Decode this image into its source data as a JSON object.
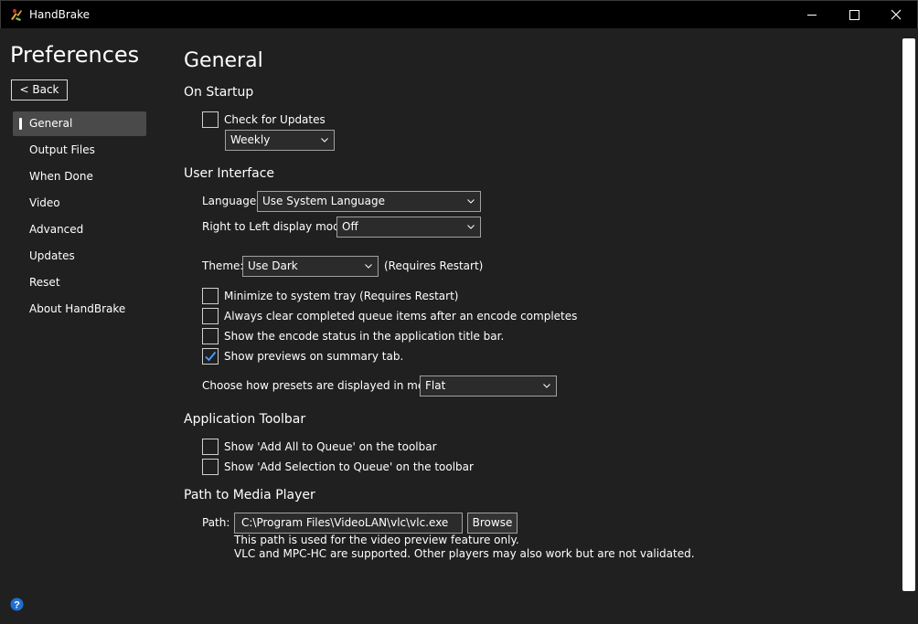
{
  "window": {
    "title": "HandBrake"
  },
  "sidebar": {
    "title": "Preferences",
    "back_label": "< Back",
    "items": [
      {
        "label": "General",
        "active": true
      },
      {
        "label": "Output Files"
      },
      {
        "label": "When Done"
      },
      {
        "label": "Video"
      },
      {
        "label": "Advanced"
      },
      {
        "label": "Updates"
      },
      {
        "label": "Reset"
      },
      {
        "label": "About HandBrake"
      }
    ]
  },
  "main": {
    "page_title": "General",
    "startup": {
      "heading": "On Startup",
      "check_updates": {
        "label": "Check for Updates",
        "checked": false
      },
      "frequency": {
        "value": "Weekly"
      }
    },
    "ui": {
      "heading": "User Interface",
      "language_label": "Language:",
      "language_value": "Use System Language",
      "rtl_label": "Right to Left display mode:",
      "rtl_value": "Off",
      "theme_label": "Theme:",
      "theme_value": "Use Dark",
      "theme_note": "(Requires Restart)",
      "options": [
        {
          "label": "Minimize to system tray (Requires Restart)",
          "checked": false
        },
        {
          "label": "Always clear completed queue items after an encode completes",
          "checked": false
        },
        {
          "label": "Show the encode status in the application title bar.",
          "checked": false
        },
        {
          "label": "Show previews on summary tab.",
          "checked": true
        }
      ],
      "presets_label": "Choose how presets are displayed in menus:",
      "presets_value": "Flat"
    },
    "toolbar": {
      "heading": "Application Toolbar",
      "options": [
        {
          "label": "Show 'Add All to Queue' on the toolbar",
          "checked": false
        },
        {
          "label": "Show 'Add Selection to Queue' on the toolbar",
          "checked": false
        }
      ]
    },
    "media_player": {
      "heading": "Path to Media Player",
      "path_label": "Path:",
      "path_value": "C:\\Program Files\\VideoLAN\\vlc\\vlc.exe",
      "browse_label": "Browse",
      "note_1": "This path is used for the video preview feature only.",
      "note_2": "VLC and MPC-HC are supported. Other players may also work but are not validated."
    }
  },
  "colors": {
    "background": "#202020",
    "titlebar": "#000000",
    "selected_nav": "#4a4a4a",
    "checkmark": "#4aa0ff"
  },
  "icons": {
    "app": "handbrake-logo-icon",
    "help": "help-icon",
    "minimize": "minimize-icon",
    "maximize": "maximize-icon",
    "close": "close-icon",
    "dropdown": "chevron-down-icon",
    "checkbox": "checkmark-icon"
  }
}
